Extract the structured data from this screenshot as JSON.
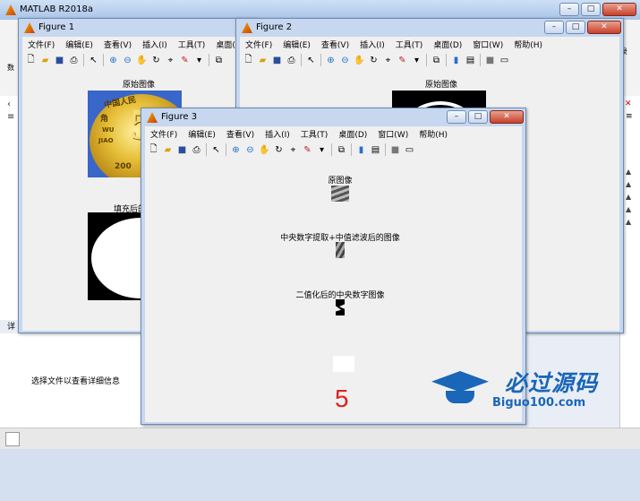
{
  "main": {
    "title": "MATLAB R2018a",
    "left_label": "详",
    "details_text": "选择文件以查看详细信息",
    "right_fragment": "录",
    "side_fragment": "数"
  },
  "menu": [
    "文件(F)",
    "编辑(E)",
    "查看(V)",
    "插入(I)",
    "工具(T)",
    "桌面(D)",
    "窗口(W)",
    "帮助(H)"
  ],
  "fig1": {
    "title": "Figure 1",
    "ax1_title": "原始图像",
    "ax2_title": "填充后的"
  },
  "fig2": {
    "title": "Figure 2",
    "ax1_title": "原始图像"
  },
  "fig3": {
    "title": "Figure 3",
    "ax1_title": "原图像",
    "ax2_title": "中央数字提取+中值滤波后的图像",
    "ax3_title": "二值化后的中央数字图像",
    "result": "5",
    "result_color": "#e02020"
  },
  "watermark": {
    "name": "必过源码",
    "url": "Biguo100.com",
    "color": "#1a66b8"
  },
  "coin": {
    "top_text": "中国人民",
    "side_char": "角",
    "wu": "WU",
    "jiao": "JIAO",
    "year": "200"
  }
}
